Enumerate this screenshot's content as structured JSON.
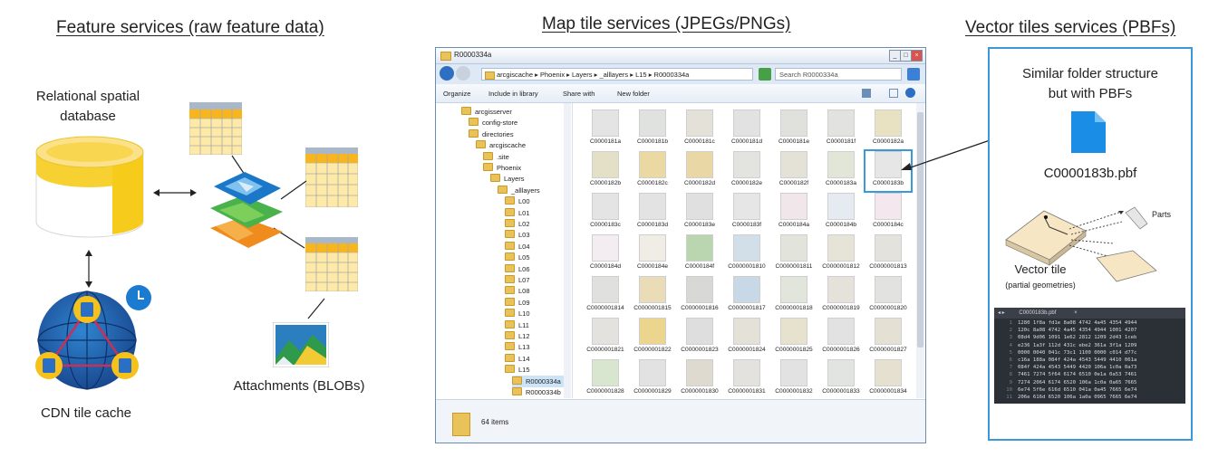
{
  "titles": {
    "feature_services": "Feature services (raw feature data)",
    "map_tiles": "Map tile services (JPEGs/PNGs)",
    "vector_tiles": "Vector tiles services (PBFs)"
  },
  "labels": {
    "relational_db_line1": "Relational spatial",
    "relational_db_line2": "database",
    "cdn_cache": "CDN tile cache",
    "attachments": "Attachments (BLOBs)"
  },
  "icons": {
    "database": "database-icon",
    "globe": "cdn-globe-icon",
    "clock": "clock-icon",
    "layers": "map-layers-icon",
    "table": "table-icon",
    "attachment": "map-image-icon",
    "file": "pbf-file-icon",
    "folder": "folder-icon"
  },
  "colors": {
    "db_yellow": "#f6cb1b",
    "panel_blue": "#3a9ad9",
    "table_header": "#f9b61c",
    "table_cell": "#fde9a8",
    "globe_blue": "#1f5fa8",
    "clock_blue": "#1a7bd1"
  },
  "explorer": {
    "window_title": "R0000334a",
    "path": [
      "arcgiscache",
      "Phoenix",
      "Layers",
      "_alllayers",
      "L15",
      "R0000334a"
    ],
    "search_placeholder": "Search R0000334a",
    "toolbar": {
      "organize": "Organize",
      "include": "Include in library",
      "share": "Share with",
      "new_folder": "New folder"
    },
    "tree": [
      {
        "label": "arcgisserver",
        "indent": 0
      },
      {
        "label": "config-store",
        "indent": 1
      },
      {
        "label": "directories",
        "indent": 1
      },
      {
        "label": "arcgiscache",
        "indent": 2
      },
      {
        "label": ".site",
        "indent": 3
      },
      {
        "label": "Phoenix",
        "indent": 3
      },
      {
        "label": "Layers",
        "indent": 4
      },
      {
        "label": "_alllayers",
        "indent": 5
      },
      {
        "label": "L00",
        "indent": 6
      },
      {
        "label": "L01",
        "indent": 6
      },
      {
        "label": "L02",
        "indent": 6
      },
      {
        "label": "L03",
        "indent": 6
      },
      {
        "label": "L04",
        "indent": 6
      },
      {
        "label": "L05",
        "indent": 6
      },
      {
        "label": "L06",
        "indent": 6
      },
      {
        "label": "L07",
        "indent": 6
      },
      {
        "label": "L08",
        "indent": 6
      },
      {
        "label": "L09",
        "indent": 6
      },
      {
        "label": "L10",
        "indent": 6
      },
      {
        "label": "L11",
        "indent": 6
      },
      {
        "label": "L12",
        "indent": 6
      },
      {
        "label": "L13",
        "indent": 6
      },
      {
        "label": "L14",
        "indent": 6
      },
      {
        "label": "L15",
        "indent": 6
      },
      {
        "label": "R0000334a",
        "indent": 7
      },
      {
        "label": "R0000334b",
        "indent": 7
      }
    ],
    "files": [
      [
        "C0000181a",
        "C0000181b",
        "C0000181c",
        "C0000181d",
        "C0000181e",
        "C0000181f",
        "C0000182a"
      ],
      [
        "C0000182b",
        "C0000182c",
        "C0000182d",
        "C0000182e",
        "C0000182f",
        "C0000183a",
        "C0000183b"
      ],
      [
        "C0000183c",
        "C0000183d",
        "C0000183e",
        "C0000183f",
        "C0000184a",
        "C0000184b",
        "C0000184c"
      ],
      [
        "C0000184d",
        "C0000184e",
        "C0000184f",
        "C0000001810",
        "C0000001811",
        "C0000001812",
        "C0000001813"
      ],
      [
        "C0000001814",
        "C0000001815",
        "C0000001816",
        "C0000001817",
        "C0000001818",
        "C0000001819",
        "C0000001820"
      ],
      [
        "C0000001821",
        "C0000001822",
        "C0000001823",
        "C0000001824",
        "C0000001825",
        "C0000001826",
        "C0000001827"
      ],
      [
        "C0000001828",
        "C0000001829",
        "C0000001830",
        "C0000001831",
        "C0000001832",
        "C0000001833",
        "C0000001834"
      ],
      [
        "",
        "",
        "",
        "",
        "",
        "",
        ""
      ]
    ],
    "file_tints": [
      [
        "#e4e4e4",
        "#e0e2e0",
        "#e3e1d8",
        "#e2e2e2",
        "#e0e0dc",
        "#e2e2de",
        "#e9e2c2"
      ],
      [
        "#e4e0c8",
        "#ead9a2",
        "#e9d7a6",
        "#e3e3e0",
        "#e4e2d6",
        "#e2e6d6",
        "#e6e6e6"
      ],
      [
        "#e4e4e4",
        "#e3e3e3",
        "#e0e0e0",
        "#e6e6e6",
        "#f1e6ea",
        "#e6eaf1",
        "#f4e8ee"
      ],
      [
        "#f3ecf1",
        "#f0ece6",
        "#b9d6b1",
        "#d2dfe8",
        "#e2e4dc",
        "#e6e4d6",
        "#e4e2dc"
      ],
      [
        "#e0e0de",
        "#eadcb6",
        "#d8d9d4",
        "#c9d8e6",
        "#e0e6dc",
        "#e4e2da",
        "#e2e2e0"
      ],
      [
        "#e4e2de",
        "#ecd58e",
        "#dedede",
        "#e4e2d8",
        "#e6e2ce",
        "#e2e2e2",
        "#e4e0d4"
      ],
      [
        "#d9e6cf",
        "#e2e2e2",
        "#dedad0",
        "#e4e2de",
        "#e2e2e2",
        "#e2e4e2",
        "#e6e0d0"
      ],
      [
        "#d8e4d0",
        "#e2e2e2",
        "#e6d59a",
        "#c6dbc2",
        "#e4e0d6",
        "#e2e2e2",
        "#e4e4e4"
      ]
    ],
    "selected_file": "C0000183b",
    "status": "64 items"
  },
  "vector_panel": {
    "caption_line1": "Similar folder structure",
    "caption_line2": "but with PBFs",
    "file_name": "C0000183b.pbf",
    "parts_label": "Parts",
    "tile_label": "Vector tile",
    "tile_sublabel": "(partial geometries)",
    "hex_tab": "C0000183b.pbf",
    "hex_lines": [
      "1280 1f8a fd1e 8a08 4742 4a45 4354 4944",
      "120c 8a08 4742 4a45 4354 4944 1001 4207",
      "08d4 9d06 1091 1e62 2812 1209 2d43 1ceb",
      "e236 1a3f 112d 431c ebe2 361a 3f1a 1209",
      "0000 0040 041c 73c1 1100 0000 c014 d77c",
      "c16a 188a 084f 424a 4543 5449 4410 061a",
      "084f 424a 4543 5449 4420 106a 1c0a 0a73",
      "7461 7274 5f64 6174 6510 0e1a 0a53 7461",
      "7274 2064 6174 6520 106a 1c0a 0a65 7665",
      "6e74 5f6e 616d 6510 041a 0a45 7665 6e74",
      "206e 616d 6520 106a 1a0a 0965 7665 6e74"
    ]
  }
}
